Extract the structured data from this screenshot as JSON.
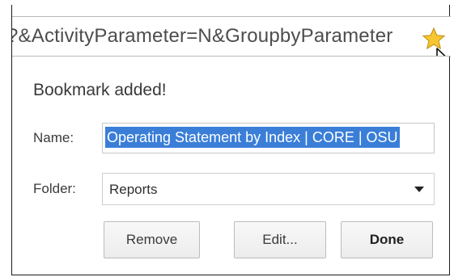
{
  "omnibox": {
    "url_text": "?&ActivityParameter=N&GroupbyParameter",
    "star_icon": "bookmark-star-icon",
    "star_color": "#f7c630"
  },
  "bookmark_bubble": {
    "title": "Bookmark added!",
    "name_label": "Name:",
    "name_value": "Operating Statement by Index | CORE | OSU",
    "folder_label": "Folder:",
    "folder_value": "Reports",
    "buttons": {
      "remove": "Remove",
      "edit": "Edit...",
      "done": "Done"
    }
  },
  "colors": {
    "selection": "#3a7ed8",
    "border": "#1b1b1b"
  }
}
